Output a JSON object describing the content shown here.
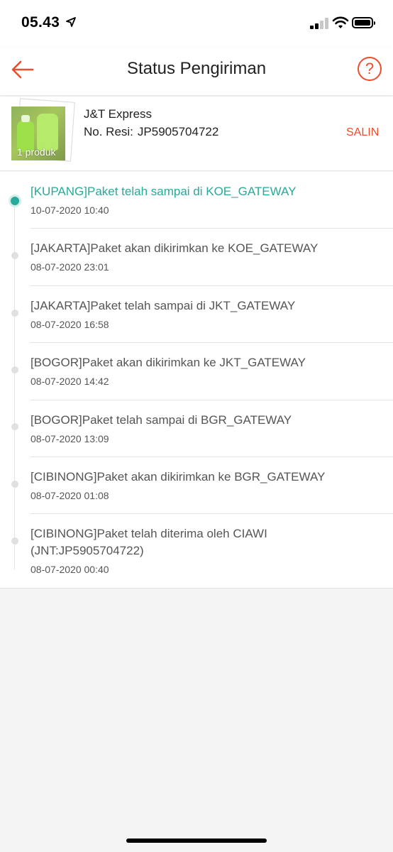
{
  "status_bar": {
    "time": "05.43"
  },
  "header": {
    "title": "Status Pengiriman",
    "help_label": "?"
  },
  "shipment": {
    "courier": "J&T Express",
    "resi_label": "No. Resi:",
    "resi_number": "JP5905704722",
    "copy_label": "SALIN",
    "product_count_label": "1 produk"
  },
  "timeline": [
    {
      "text": "[KUPANG]Paket telah sampai di KOE_GATEWAY",
      "time": "10-07-2020 10:40",
      "active": true
    },
    {
      "text": "[JAKARTA]Paket akan dikirimkan ke KOE_GATEWAY",
      "time": "08-07-2020 23:01",
      "active": false
    },
    {
      "text": "[JAKARTA]Paket telah sampai di JKT_GATEWAY",
      "time": "08-07-2020 16:58",
      "active": false
    },
    {
      "text": "[BOGOR]Paket akan dikirimkan ke JKT_GATEWAY",
      "time": "08-07-2020 14:42",
      "active": false
    },
    {
      "text": "[BOGOR]Paket telah sampai di BGR_GATEWAY",
      "time": "08-07-2020 13:09",
      "active": false
    },
    {
      "text": "[CIBINONG]Paket akan dikirimkan ke BGR_GATEWAY",
      "time": "08-07-2020 01:08",
      "active": false
    },
    {
      "text": "[CIBINONG]Paket telah diterima oleh CIAWI (JNT:JP5905704722)",
      "time": "08-07-2020 00:40",
      "active": false
    }
  ],
  "colors": {
    "accent": "#ee4d2d",
    "active_status": "#26aa99"
  }
}
